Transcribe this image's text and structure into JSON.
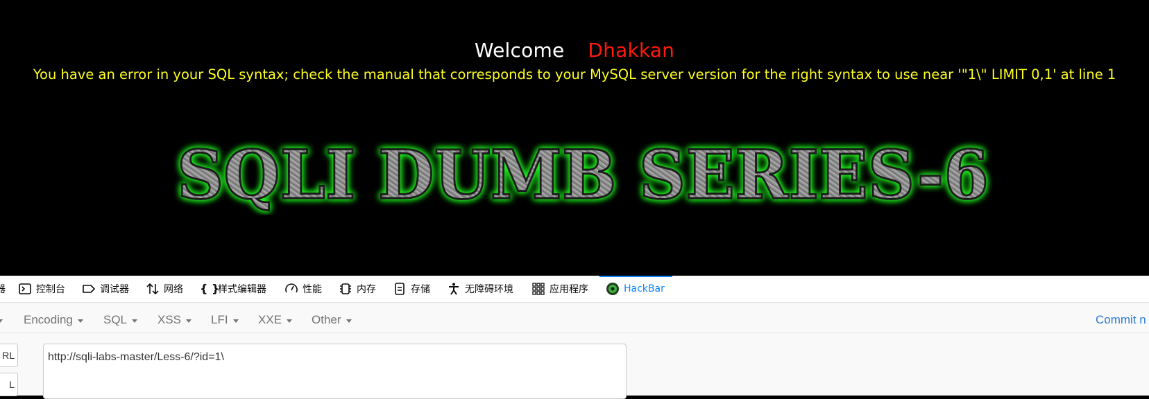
{
  "page": {
    "welcome_label": "Welcome",
    "user_name": "Dhakkan",
    "error_message": "You have an error in your SQL syntax; check the manual that corresponds to your MySQL server version for the right syntax to use near '\"1\\\" LIMIT 0,1' at line 1",
    "banner_text": "SQLI DUMB SERIES-6"
  },
  "devtools": {
    "tabs": [
      {
        "label": "器",
        "icon": "inspector-icon"
      },
      {
        "label": "控制台",
        "icon": "console-icon"
      },
      {
        "label": "调试器",
        "icon": "debugger-icon"
      },
      {
        "label": "网络",
        "icon": "network-icon"
      },
      {
        "label": "样式编辑器",
        "icon": "style-editor-icon"
      },
      {
        "label": "性能",
        "icon": "performance-icon"
      },
      {
        "label": "内存",
        "icon": "memory-icon"
      },
      {
        "label": "存储",
        "icon": "storage-icon"
      },
      {
        "label": "无障碍环境",
        "icon": "accessibility-icon"
      },
      {
        "label": "应用程序",
        "icon": "application-icon"
      },
      {
        "label": "HackBar",
        "icon": "hackbar-icon",
        "active": true
      }
    ],
    "accent_color": "#0a84ff"
  },
  "hackbar": {
    "menus": [
      "Encoding",
      "SQL",
      "XSS",
      "LFI",
      "XXE",
      "Other"
    ],
    "commit_label": "Commit n",
    "side_buttons": [
      "RL",
      "L"
    ],
    "url_value": "http://sqli-labs-master/Less-6/?id=1\\"
  }
}
